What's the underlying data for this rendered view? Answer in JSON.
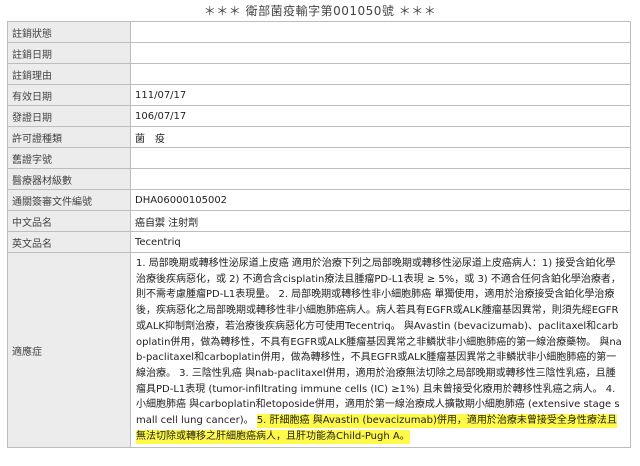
{
  "header": {
    "title": "＊＊＊ 衛部菌疫輸字第001050號 ＊＊＊"
  },
  "rows": [
    {
      "label": "註銷狀態",
      "value": ""
    },
    {
      "label": "註銷日期",
      "value": ""
    },
    {
      "label": "註銷理由",
      "value": ""
    },
    {
      "label": "有效日期",
      "value": "111/07/17"
    },
    {
      "label": "發證日期",
      "value": "106/07/17"
    },
    {
      "label": "許可證種類",
      "value": "菌　疫"
    },
    {
      "label": "舊證字號",
      "value": ""
    },
    {
      "label": "醫療器材級數",
      "value": ""
    },
    {
      "label": "通關簽審文件編號",
      "value": "DHA06000105002"
    },
    {
      "label": "中文品名",
      "value": "癌自禦 注射劑"
    },
    {
      "label": "英文品名",
      "value": "Tecentriq"
    }
  ],
  "indication": {
    "label": "適應症",
    "text_main": "1. 局部晚期或轉移性泌尿道上皮癌 適用於治療下列之局部晚期或轉移性泌尿道上皮癌病人：1) 接受含鉑化學治療後疾病惡化，或 2) 不適合含cisplatin療法且腫瘤PD-L1表現 ≥ 5%，或 3) 不適合任何含鉑化學治療者，則不需考慮腫瘤PD-L1表現量。 2. 局部晚期或轉移性非小細胞肺癌 單獨使用，適用於治療接受含鉑化學治療後，疾病惡化之局部晚期或轉移性非小細胞肺癌病人。病人若具有EGFR或ALK腫瘤基因異常，則須先經EGFR或ALK抑制劑治療，若治療後疾病惡化方可使用Tecentriq。 與Avastin (bevacizumab)、paclitaxel和carboplatin併用，做為轉移性，不具有EGFR或ALK腫瘤基因異常之非鱗狀非小細胞肺癌的第一線治療藥物。 與nab-paclitaxel和carboplatin併用，做為轉移性，不具EGFR或ALK腫瘤基因異常之非鱗狀非小細胞肺癌的第一線治療。 3. 三陰性乳癌 與nab-paclitaxel併用，適用於治療無法切除之局部晚期或轉移性三陰性乳癌，且腫瘤具PD-L1表現 (tumor-infiltrating immune cells (IC) ≥1%) 且未曾接受化療用於轉移性乳癌之病人。 4. 小細胞肺癌 與carboplatin和etoposide併用，適用於第一線治療成人擴散期小細胞肺癌 (extensive stage small cell lung cancer)。",
    "text_highlight": "5. 肝細胞癌 與Avastin (bevacizumab)併用，適用於治療未曾接受全身性療法且無法切除或轉移之肝細胞癌病人，且肝功能為Child-Pugh A。"
  }
}
